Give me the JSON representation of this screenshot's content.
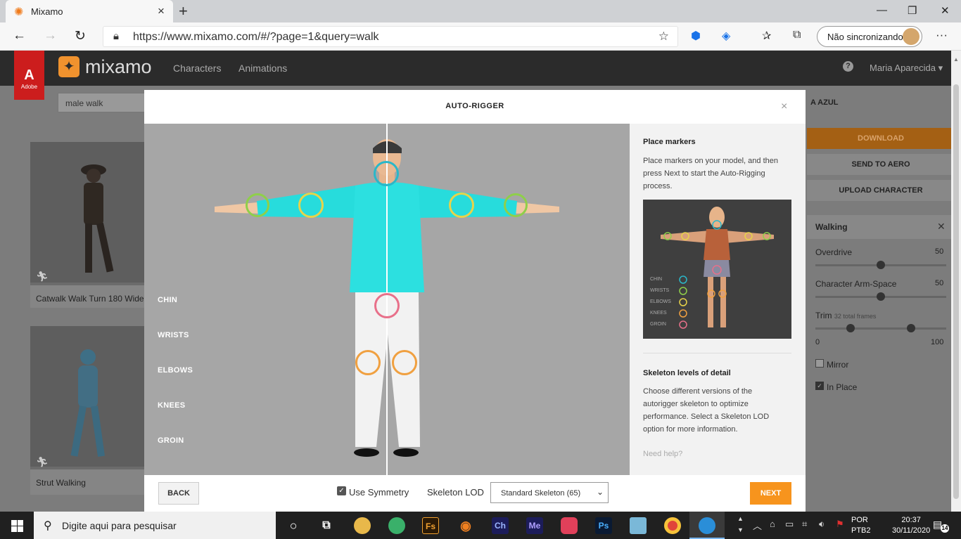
{
  "browser": {
    "tab_title": "Mixamo",
    "tab_close": "×",
    "new_tab": "+",
    "url": "https://www.mixamo.com/#/?page=1&query=walk",
    "sync_label": "Não sincronizando",
    "win_min": "—",
    "win_max": "❐",
    "win_close": "✕"
  },
  "mixamo": {
    "brand": "mixamo",
    "adobe_label": "Adobe",
    "nav": [
      "Characters",
      "Animations"
    ],
    "user": "Maria Aparecida",
    "search_value": "male walk",
    "cards": [
      {
        "caption": "Catwalk Walk Turn 180 Wide"
      },
      {
        "caption": "Strut Walking"
      }
    ],
    "right_panel": {
      "character_name": "A AZUL",
      "download": "DOWNLOAD",
      "send_aero": "SEND TO AERO",
      "upload": "UPLOAD CHARACTER",
      "anim_title": "Walking",
      "overdrive_label": "Overdrive",
      "overdrive_value": "50",
      "armspace_label": "Character Arm-Space",
      "armspace_value": "50",
      "trim_label": "Trim",
      "trim_frames": "32 total frames",
      "trim_min": "0",
      "trim_max": "100",
      "mirror_label": "Mirror",
      "inplace_label": "In Place"
    }
  },
  "modal": {
    "title": "AUTO-RIGGER",
    "close": "×",
    "marker_labels": [
      "CHIN",
      "WRISTS",
      "ELBOWS",
      "KNEES",
      "GROIN"
    ],
    "place_markers_heading": "Place markers",
    "place_markers_text": "Place markers on your model, and then press Next to start the Auto-Rigging process.",
    "thumb_labels": [
      "CHIN",
      "WRISTS",
      "ELBOWS",
      "KNEES",
      "GROIN"
    ],
    "skeleton_heading": "Skeleton levels of detail",
    "skeleton_text": "Choose different versions of the autorigger skeleton to optimize performance. Select a Skeleton LOD option for more information.",
    "need_help": "Need help?",
    "back": "BACK",
    "use_symmetry": "Use Symmetry",
    "skeleton_lod_label": "Skeleton LOD",
    "skeleton_lod_value": "Standard Skeleton (65)",
    "next": "NEXT",
    "colors": {
      "chin": "#2ab7c9",
      "wrists": "#8fcf4a",
      "elbows": "#e7d34a",
      "knees": "#f0a040",
      "groin": "#e8708a"
    }
  },
  "taskbar": {
    "search_placeholder": "Digite aqui para pesquisar",
    "apps": [
      "Fs",
      "Ch",
      "Me",
      "Ps"
    ],
    "lang_top": "POR",
    "lang_bottom": "PTB2",
    "time": "20:37",
    "date": "30/11/2020",
    "notifications": "14"
  }
}
